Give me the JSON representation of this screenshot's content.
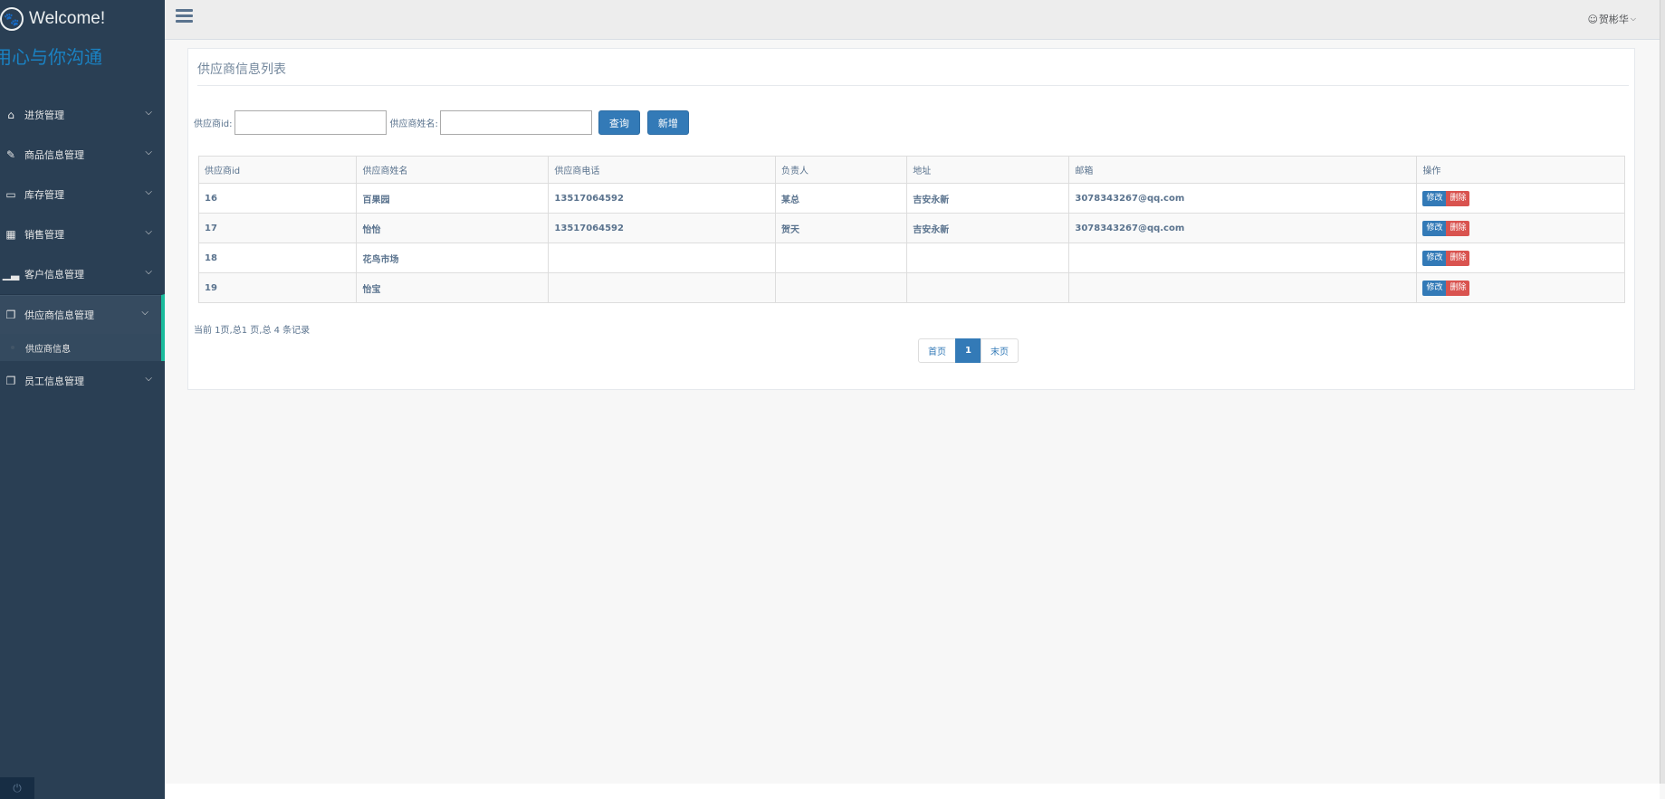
{
  "sidebar": {
    "brand": "Welcome!",
    "slogan": "用心与你沟通",
    "items": [
      {
        "label": "进货管理",
        "icon": "home-icon"
      },
      {
        "label": "商品信息管理",
        "icon": "edit-icon"
      },
      {
        "label": "库存管理",
        "icon": "desktop-icon"
      },
      {
        "label": "销售管理",
        "icon": "table-icon"
      },
      {
        "label": "客户信息管理",
        "icon": "bar-chart-icon"
      },
      {
        "label": "供应商信息管理",
        "icon": "clone-icon"
      },
      {
        "label": "员工信息管理",
        "icon": "clone-icon"
      }
    ],
    "sub_active": "供应商信息"
  },
  "topnav": {
    "user_name": "贺彬华"
  },
  "panel": {
    "title": "供应商信息列表"
  },
  "search": {
    "id_label": "供应商id:",
    "id_value": "",
    "name_label": "供应商姓名:",
    "name_value": "",
    "query_label": "查询",
    "add_label": "新增"
  },
  "table": {
    "headers": [
      "供应商id",
      "供应商姓名",
      "供应商电话",
      "负责人",
      "地址",
      "邮箱",
      "操作"
    ],
    "rows": [
      {
        "id": "16",
        "name": "百果园",
        "phone": "13517064592",
        "contact": "某总",
        "address": "吉安永新",
        "email": "3078343267@qq.com"
      },
      {
        "id": "17",
        "name": "怡怡",
        "phone": "13517064592",
        "contact": "贺天",
        "address": "吉安永新",
        "email": "3078343267@qq.com"
      },
      {
        "id": "18",
        "name": "花鸟市场",
        "phone": "",
        "contact": "",
        "address": "",
        "email": ""
      },
      {
        "id": "19",
        "name": "怡宝",
        "phone": "",
        "contact": "",
        "address": "",
        "email": ""
      }
    ],
    "edit_label": "修改",
    "delete_label": "删除"
  },
  "paging": {
    "info": "当前 1页,总1 页,总 4 条记录",
    "first": "首页",
    "current": "1",
    "last": "末页"
  },
  "colors": {
    "sidebar_bg": "#2a3f54",
    "accent": "#1abb9c",
    "primary": "#337ab7",
    "danger": "#d9534f"
  }
}
